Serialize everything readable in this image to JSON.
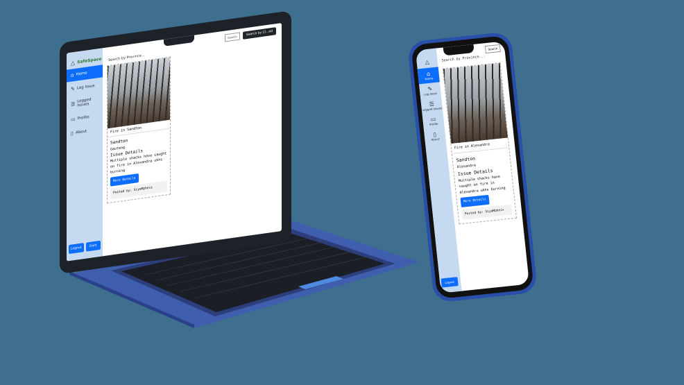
{
  "app": {
    "brand": "SafeSpace",
    "search_label": "Search by Province...",
    "search_placeholder": "Search",
    "search_button": "Search by Cl...ed",
    "nav": [
      {
        "label": "Home",
        "icon": "home-icon"
      },
      {
        "label": "Log Issue",
        "icon": "edit-icon"
      },
      {
        "label": "Logged Issues",
        "icon": "list-icon"
      },
      {
        "label": "Profile",
        "icon": "profile-icon"
      },
      {
        "label": "About",
        "icon": "info-icon"
      }
    ],
    "sidebar_buttons": [
      "Logout",
      "Dark"
    ],
    "card": {
      "caption_laptop": "Fire in Sandton",
      "caption_phone": "Fire in Alexandra",
      "location": "Sandton",
      "province_laptop": "Gauteng",
      "province_phone": "Alexandra",
      "details_title": "Issue Details",
      "details_text": "Multiple shacks have caught on fire in Alexandra ukhs burning",
      "button": "More Details",
      "posted_by": "Posted by: SiyaMpheis"
    }
  }
}
